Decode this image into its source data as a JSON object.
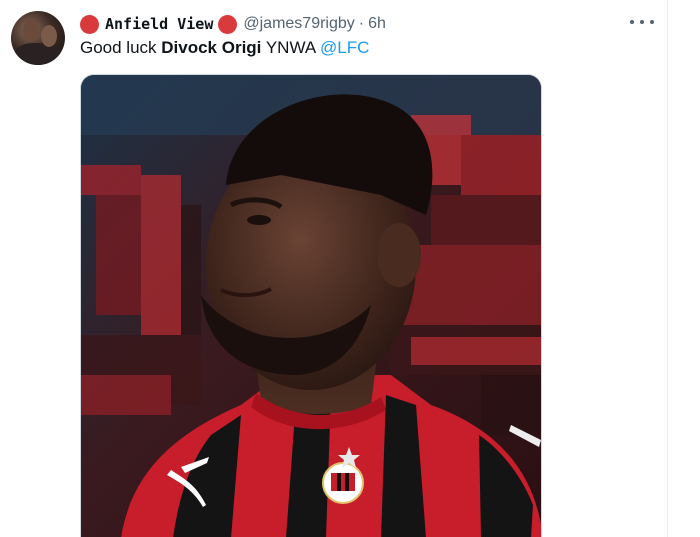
{
  "tweet": {
    "display_name": "Anfield View",
    "name_emoji": "red-circle",
    "handle": "@james79rigby",
    "separator": "·",
    "time": "6h",
    "text_prefix": "Good luck ",
    "text_bold": "Divock Origi",
    "text_mid": " YNWA ",
    "mention": "@LFC",
    "media_alt": "photo",
    "colors": {
      "accent": "#1d9bf0",
      "muted": "#536471",
      "emoji_red": "#d93a3e",
      "jersey_red": "#d1202f",
      "jersey_black": "#111111"
    }
  },
  "icons": {
    "more": "more-horizontal-icon"
  }
}
